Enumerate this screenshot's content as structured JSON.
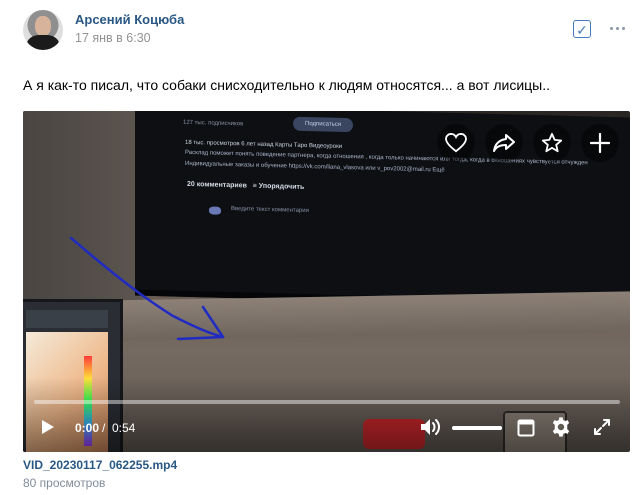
{
  "post": {
    "author": "Арсений Коцюба",
    "time": "17 янв в 6:30",
    "text": "А я как-то писал, что собаки снисходительно к людям относятся... а вот лисицы.."
  },
  "icons": {
    "check": "check-square-icon",
    "more": "more-horizontal-icon",
    "like": "heart-icon",
    "share": "share-arrow-icon",
    "favorite": "star-icon",
    "add": "plus-icon",
    "play": "play-icon",
    "volume": "volume-icon",
    "pip": "picture-in-picture-icon",
    "settings": "gear-icon",
    "fullscreen": "fullscreen-icon"
  },
  "video": {
    "current_time": "0:00",
    "separator": "/",
    "duration": "0:54",
    "progress_fraction": 0,
    "volume_fraction": 1,
    "file_name": "VID_20230117_062255.mp4",
    "views": "80 просмотров",
    "screen_text": {
      "channel": "127 тыс. подписчиков",
      "subscribe": "Подписаться",
      "line1": "18 тыс. просмотров  6 лет назад  Карты Таро  Видеоуроки",
      "line2": "Расклад поможет понять поведение партнера, когда отношения , когда только начинаются или тогда, когда в отношениях чувствуется отчужден",
      "line3": "Индивидуальные заказы и обучение https://vk.com/liana_vlasova или v_pov2002@mail.ru  Ещё",
      "comments": "20 комментариев",
      "sort": "Упорядочить",
      "comment_input": "Введите текст комментария"
    }
  },
  "colors": {
    "link": "#2a5885",
    "secondary": "#939393",
    "accent": "#447bba"
  }
}
